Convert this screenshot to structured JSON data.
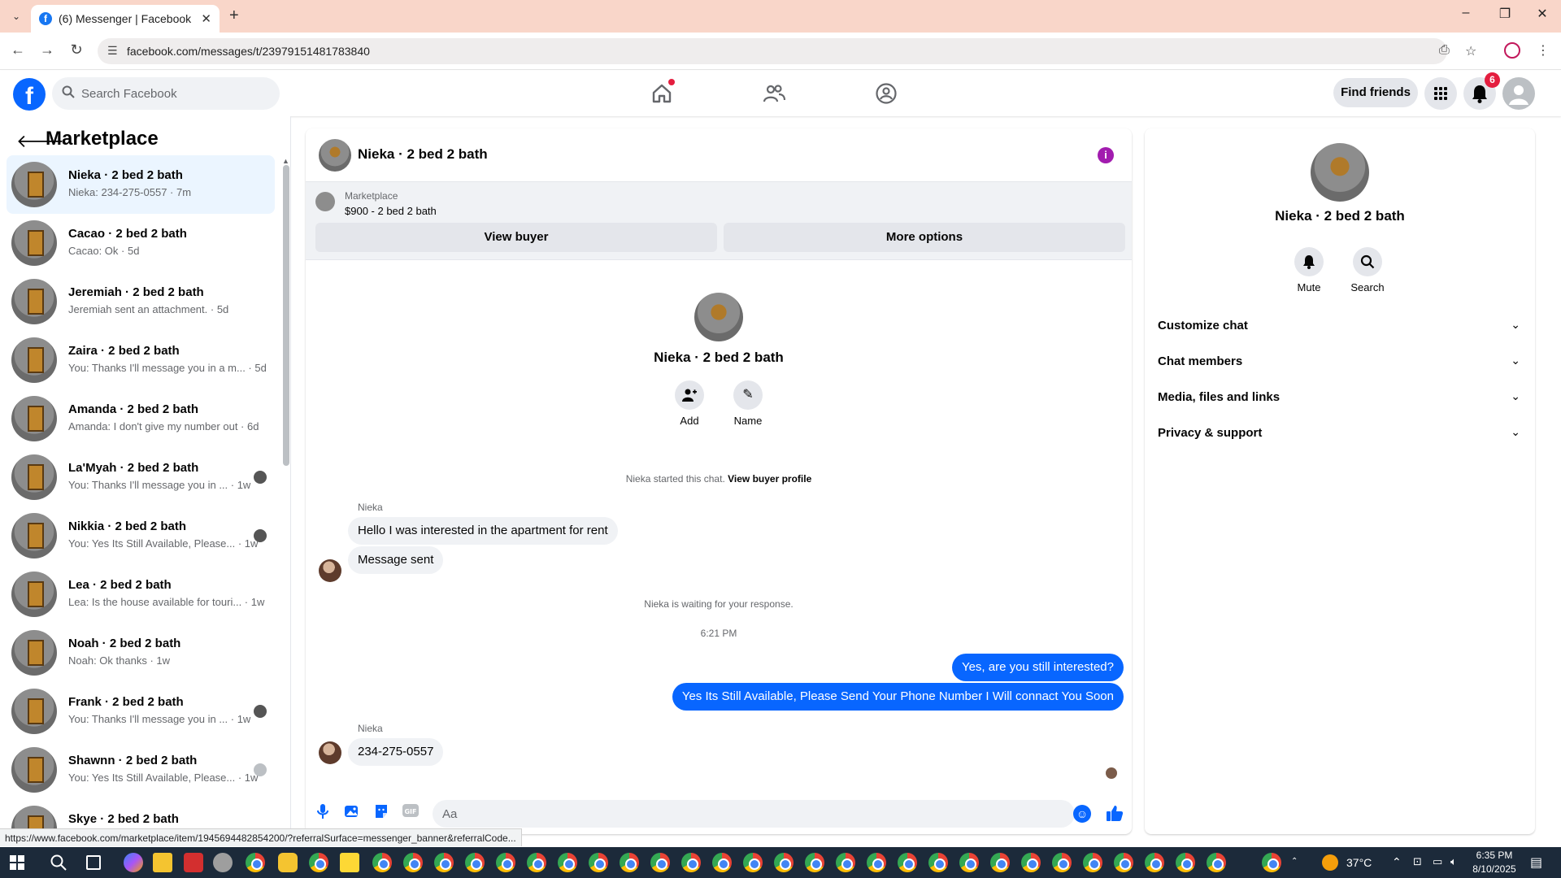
{
  "browser": {
    "tab_title": "(6) Messenger | Facebook",
    "url": "facebook.com/messages/t/23979151481783840",
    "status_url": "https://www.facebook.com/marketplace/item/1945694482854200/?referralSurface=messenger_banner&referralCode..."
  },
  "fb_header": {
    "search_placeholder": "Search Facebook",
    "find_friends": "Find friends",
    "notification_count": "6"
  },
  "left": {
    "title": "Marketplace",
    "conversations": [
      {
        "name": "Nieka · 2 bed 2 bath",
        "snippet": "Nieka: 234-275-0557 · 7m",
        "seen": false
      },
      {
        "name": "Cacao · 2 bed 2 bath",
        "snippet": "Cacao: Ok · 5d",
        "seen": false
      },
      {
        "name": "Jeremiah · 2 bed 2 bath",
        "snippet": "Jeremiah sent an attachment. · 5d",
        "seen": false
      },
      {
        "name": "Zaira · 2 bed 2 bath",
        "snippet": "You: Thanks I'll message you in a m... · 5d",
        "seen": false
      },
      {
        "name": "Amanda · 2 bed 2 bath",
        "snippet": "Amanda: I don't give my number out · 6d",
        "seen": false
      },
      {
        "name": "La'Myah · 2 bed 2 bath",
        "snippet": "You: Thanks I'll message you in ... · 1w",
        "seen": true
      },
      {
        "name": "Nikkia · 2 bed 2 bath",
        "snippet": "You: Yes Its Still Available, Please... · 1w",
        "seen": true
      },
      {
        "name": "Lea · 2 bed 2 bath",
        "snippet": "Lea: Is the house available for touri... · 1w",
        "seen": false
      },
      {
        "name": "Noah · 2 bed 2 bath",
        "snippet": "Noah: Ok thanks · 1w",
        "seen": false
      },
      {
        "name": "Frank · 2 bed 2 bath",
        "snippet": "You: Thanks I'll message you in ... · 1w",
        "seen": true
      },
      {
        "name": "Shawnn · 2 bed 2 bath",
        "snippet": "You: Yes Its Still Available, Please... · 1w",
        "seen": true
      },
      {
        "name": "Skye · 2 bed 2 bath",
        "snippet": "",
        "seen": false
      }
    ]
  },
  "chat": {
    "name": "Nieka · 2 bed 2 bath",
    "banner": {
      "label": "Marketplace",
      "price": "$900 - 2 bed 2 bath",
      "view_buyer": "View buyer",
      "more_options": "More options"
    },
    "intro": {
      "name": "Nieka · 2 bed 2 bath",
      "add_label": "Add",
      "name_label": "Name"
    },
    "started_text": "Nieka started this chat.",
    "view_buyer_profile": "View buyer profile",
    "sender_name": "Nieka",
    "msg_1": "Hello I was interested in the apartment for rent",
    "msg_2": "Message sent",
    "waiting_text": "Nieka is waiting for your response.",
    "timestamp": "6:21 PM",
    "out_1": "Yes, are you still interested?",
    "out_2": "Yes Its Still Available, Please Send Your Phone Number I Will connact You Soon",
    "msg_3": "234-275-0557",
    "composer_placeholder": "Aa"
  },
  "right": {
    "name": "Nieka · 2 bed 2 bath",
    "mute_label": "Mute",
    "search_label": "Search",
    "rows": [
      "Customize chat",
      "Chat members",
      "Media, files and links",
      "Privacy & support"
    ]
  },
  "taskbar": {
    "temperature": "37°C",
    "time": "6:35 PM",
    "date": "8/10/2025"
  },
  "colors": {
    "fb_blue": "#0866ff",
    "active_conv_bg": "#ebf5ff",
    "notification_red": "#e41e3f",
    "info_icon": "#a21caf"
  }
}
